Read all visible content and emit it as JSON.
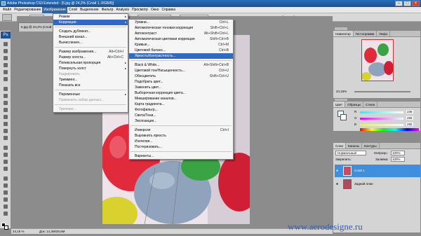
{
  "window": {
    "title": "Adobe Photoshop CS3 Extended - [5.jpg @ 24,2% (Слой 1, RGB/8)]"
  },
  "menubar": [
    "Файл",
    "Редактирование",
    "Изображение",
    "Слой",
    "Выделение",
    "Фильтр",
    "Analysis",
    "Просмотр",
    "Окно",
    "Справка"
  ],
  "optbar": {
    "fit_label": "Настр",
    "fit_screen": "По размеру экрана",
    "print_size": "Размер оттиска",
    "workspace": "Рабочая область ▾"
  },
  "doc": {
    "tab_title": "5.jpg @ 24,2% (Слой 1, RGB/8)",
    "zoom": "24,16 %",
    "doc_info": "Док: 14,3M/28,6M"
  },
  "image_menu": [
    {
      "label": "Режим",
      "arrow": "▸"
    },
    {
      "label": "Коррекция",
      "arrow": "▸",
      "selected": true
    },
    {
      "sep": true
    },
    {
      "label": "Создать дубликат..."
    },
    {
      "label": "Внешний канал..."
    },
    {
      "label": "Вычисления..."
    },
    {
      "sep": true
    },
    {
      "label": "Размер изображения...",
      "shortcut": "Alt+Ctrl+I"
    },
    {
      "label": "Размер холста...",
      "shortcut": "Alt+Ctrl+C"
    },
    {
      "label": "Попиксельная пропорция",
      "arrow": "▸"
    },
    {
      "label": "Повернуть холст",
      "arrow": "▸"
    },
    {
      "label": "Кадрировать",
      "disabled": true
    },
    {
      "label": "Тримминг..."
    },
    {
      "label": "Показать все"
    },
    {
      "sep": true
    },
    {
      "label": "Переменные",
      "arrow": "▸"
    },
    {
      "label": "Применить набор данных...",
      "disabled": true
    },
    {
      "sep": true
    },
    {
      "label": "Треппинг...",
      "disabled": true
    }
  ],
  "adjust_menu": [
    {
      "label": "Уровни...",
      "shortcut": "Ctrl+L"
    },
    {
      "label": "Автоматическая тоновая коррекция",
      "shortcut": "Shift+Ctrl+L"
    },
    {
      "label": "Автоконтраст",
      "shortcut": "Alt+Shift+Ctrl+L"
    },
    {
      "label": "Автоматическая цветовая коррекция",
      "shortcut": "Shift+Ctrl+B"
    },
    {
      "label": "Кривые...",
      "shortcut": "Ctrl+M"
    },
    {
      "label": "Цветовой баланс...",
      "shortcut": "Ctrl+B"
    },
    {
      "label": "Яркость/Контрастность...",
      "selected": true
    },
    {
      "sep": true
    },
    {
      "label": "Black & White...",
      "shortcut": "Alt+Shift+Ctrl+B"
    },
    {
      "label": "Цветовой тон/Насыщенность...",
      "shortcut": "Ctrl+U"
    },
    {
      "label": "Обесцветить",
      "shortcut": "Shift+Ctrl+U"
    },
    {
      "label": "Подобрать цвет..."
    },
    {
      "label": "Заменить цвет..."
    },
    {
      "label": "Выборочная коррекция цвета..."
    },
    {
      "label": "Микширование каналов..."
    },
    {
      "label": "Карта градиента..."
    },
    {
      "label": "Фотофильтр..."
    },
    {
      "label": "Света/Тени..."
    },
    {
      "label": "Экспозиция..."
    },
    {
      "sep": true
    },
    {
      "label": "Инверсия",
      "shortcut": "Ctrl+I"
    },
    {
      "label": "Выровнять яркость"
    },
    {
      "label": "Изогелия..."
    },
    {
      "label": "Постеризовать..."
    },
    {
      "sep": true
    },
    {
      "label": "Варианты..."
    }
  ],
  "navigator": {
    "tabs": [
      "Навигатор",
      "Гистограмма",
      "Инфо"
    ],
    "zoom": "24,16%"
  },
  "color_panel": {
    "tabs": [
      "Цвет",
      "Образцы",
      "Стили"
    ],
    "channels": [
      "R",
      "G",
      "B"
    ],
    "values": [
      "236",
      "255",
      "255"
    ]
  },
  "layers": {
    "tabs": [
      "Слои",
      "Каналы",
      "Контуры"
    ],
    "blend_mode": "Нормальный",
    "opacity_label": "Непрозр.:",
    "opacity": "100%",
    "lock_label": "Закрепить:",
    "fill_label": "Заливка:",
    "fill": "100%",
    "items": [
      {
        "name": "Слой 1",
        "selected": true
      },
      {
        "name": "Задний план"
      }
    ]
  },
  "watermark": "www.aerodesigne.ru"
}
